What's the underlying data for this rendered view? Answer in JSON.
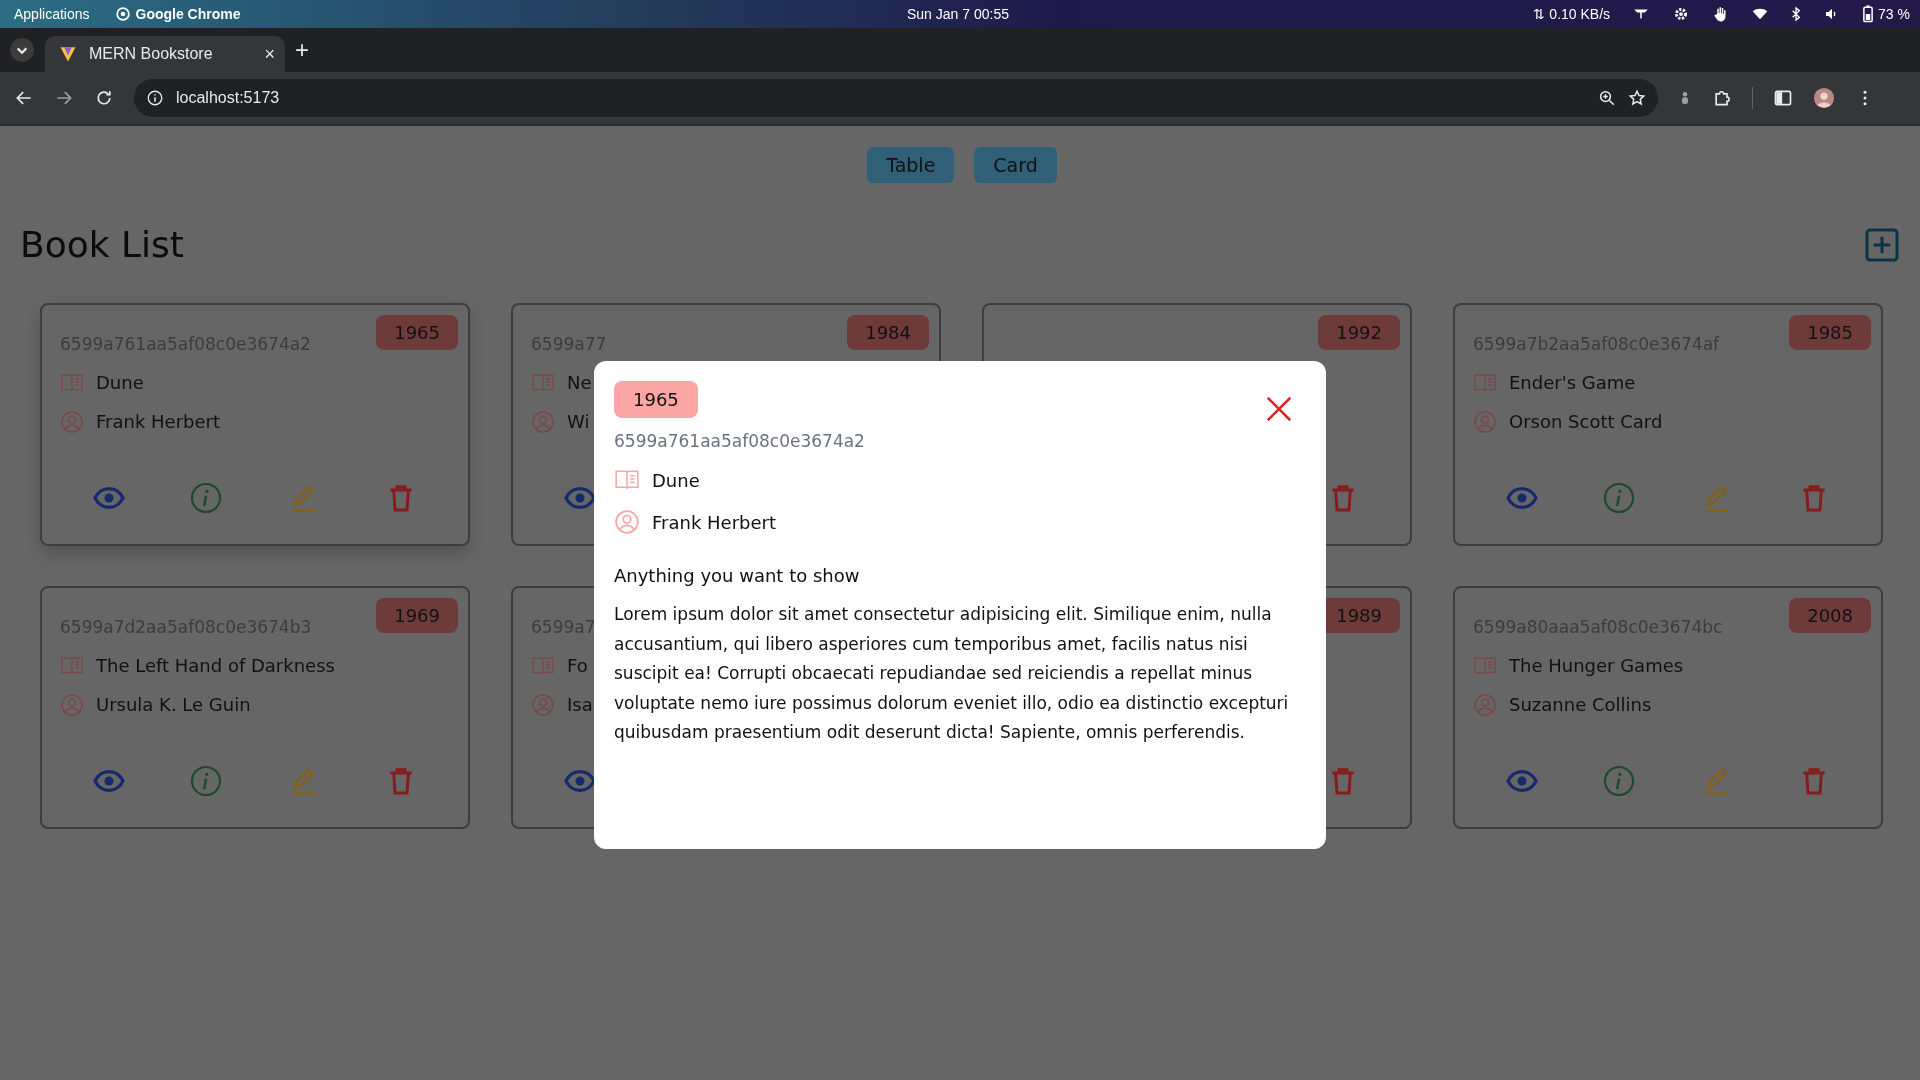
{
  "system_bar": {
    "apps_label": "Applications",
    "active_app": "Google Chrome",
    "clock": "Sun Jan 7  00:55",
    "net_speed": "⇅ 0.10 KB/s",
    "battery": "73 %"
  },
  "browser": {
    "tabs": [
      {
        "title": "MERN Bookstore",
        "close": "×",
        "selected": true
      }
    ],
    "new_tab": "+",
    "url": "localhost:5173"
  },
  "view_toggle": [
    {
      "label": "Table"
    },
    {
      "label": "Card"
    }
  ],
  "heading": "Book List",
  "books": [
    {
      "id": "6599a761aa5af08c0e3674a2",
      "title": "Dune",
      "author": "Frank Herbert",
      "year": "1965",
      "actions": [
        {
          "kind": "view"
        },
        {
          "kind": "info"
        },
        {
          "kind": "edit"
        },
        {
          "kind": "delete"
        }
      ]
    },
    {
      "id": "6599a77",
      "title": "Ne",
      "author": "Wi",
      "year": "1984",
      "actions": [
        {
          "kind": "view"
        }
      ]
    },
    {
      "year": "1992",
      "actions": [
        {
          "kind": "delete"
        }
      ]
    },
    {
      "id": "6599a7b2aa5af08c0e3674af",
      "title": "Ender's Game",
      "author": "Orson Scott Card",
      "year": "1985",
      "actions": [
        {
          "kind": "view"
        },
        {
          "kind": "info"
        },
        {
          "kind": "edit"
        },
        {
          "kind": "delete"
        }
      ]
    },
    {
      "id": "6599a7d2aa5af08c0e3674b3",
      "title": "The Left Hand of Darkness",
      "author": "Ursula K. Le Guin",
      "year": "1969",
      "actions": [
        {
          "kind": "view"
        },
        {
          "kind": "info"
        },
        {
          "kind": "edit"
        },
        {
          "kind": "delete"
        }
      ]
    },
    {
      "id": "6599a7",
      "title": "Fo",
      "author": "Isa",
      "actions": [
        {
          "kind": "view"
        }
      ]
    },
    {
      "year": "1989",
      "actions": [
        {
          "kind": "delete"
        }
      ]
    },
    {
      "id": "6599a80aaa5af08c0e3674bc",
      "title": "The Hunger Games",
      "author": "Suzanne Collins",
      "year": "2008",
      "actions": [
        {
          "kind": "view"
        },
        {
          "kind": "info"
        },
        {
          "kind": "edit"
        },
        {
          "kind": "delete"
        }
      ]
    }
  ],
  "modal": {
    "year": "1965",
    "id": "6599a761aa5af08c0e3674a2",
    "title": "Dune",
    "author": "Frank Herbert",
    "subtitle": "Anything you want to show",
    "body": "Lorem ipsum dolor sit amet consectetur adipisicing elit. Similique enim, nulla accusantium, qui libero asperiores cum temporibus amet, facilis natus nisi suscipit ea! Corrupti obcaecati repudiandae sed reiciendis a repellat minus voluptate nemo iure possimus dolorum eveniet illo, odio ea distinctio excepturi quibusdam praesentium odit deserunt dicta! Sapiente, omnis perferendis."
  }
}
